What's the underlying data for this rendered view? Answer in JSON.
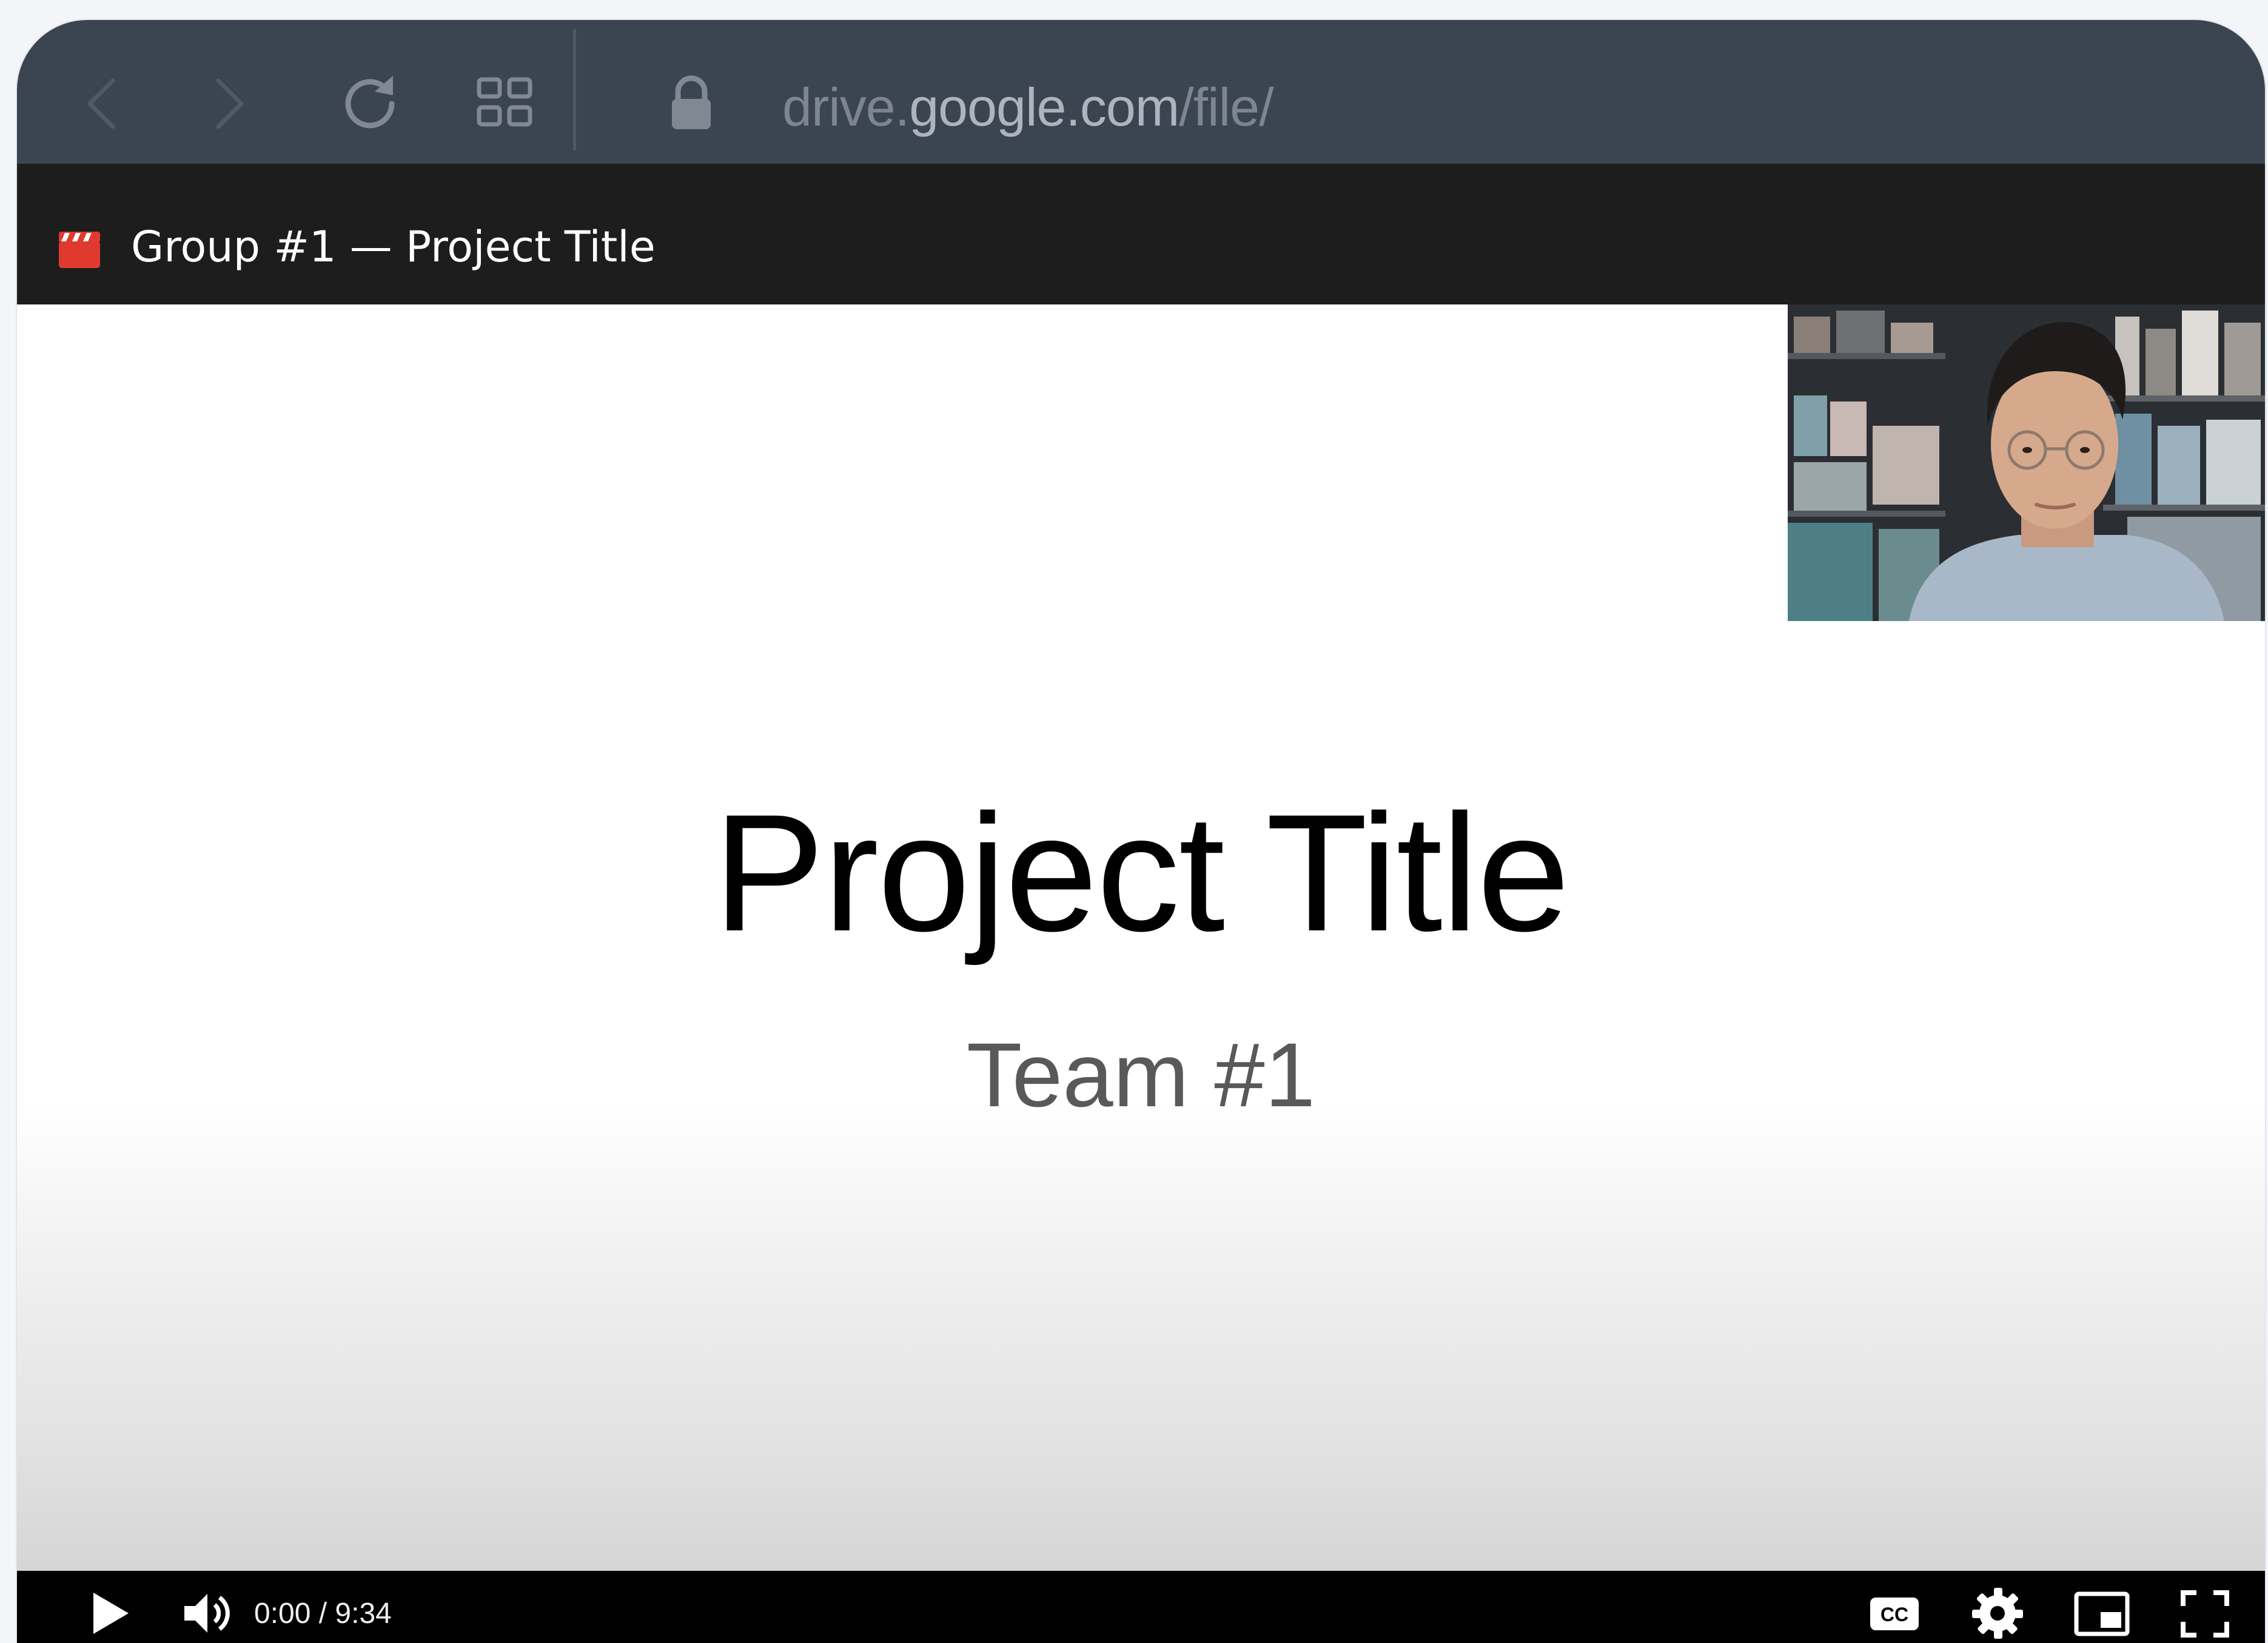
{
  "browser": {
    "url_scheme": "drive.",
    "url_domain": "google.com",
    "url_path": "/file/"
  },
  "tab": {
    "title": "Group #1 — Project Title",
    "icon": "clapperboard-icon"
  },
  "slide": {
    "title": "Project Title",
    "subtitle": "Team #1"
  },
  "player": {
    "time": "0:00 / 9:34",
    "cc_label": "CC"
  },
  "colors": {
    "browser_bar": "#3b4552",
    "title_bar": "#1d1d1e",
    "controls_bar": "#000000",
    "clapper_red": "#e03a2f"
  },
  "icons": [
    "back-arrow-icon",
    "forward-arrow-icon",
    "reload-icon",
    "tabs-grid-icon",
    "lock-icon",
    "play-icon",
    "volume-icon",
    "closed-captions-icon",
    "settings-gear-icon",
    "miniplayer-icon",
    "fullscreen-icon"
  ]
}
